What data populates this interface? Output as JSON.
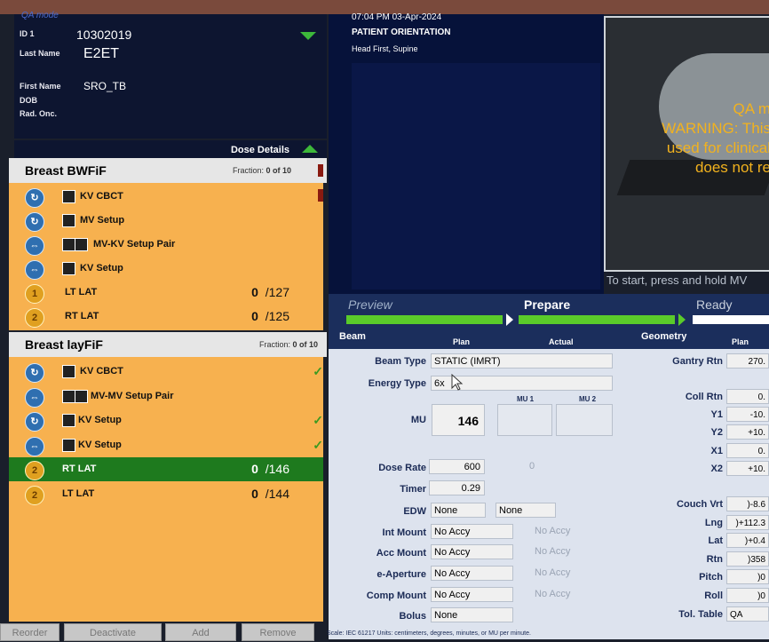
{
  "mode_label": "QA mode",
  "patient": {
    "id_label": "ID 1",
    "id_value": "10302019",
    "last_name_label": "Last Name",
    "last_name": "E2ET",
    "first_name_label": "First Name",
    "first_name": "SRO_TB",
    "dob_label": "DOB",
    "rad_onc_label": "Rad. Onc."
  },
  "dose_details_label": "Dose Details",
  "plans": [
    {
      "name": "Breast BWFiF",
      "fraction_label": "Fraction:",
      "fraction_value": "0 of 10",
      "fields": [
        {
          "name": "KV CBCT",
          "icon": "arc-icon"
        },
        {
          "name": "MV Setup",
          "icon": "arc-icon"
        },
        {
          "name": "MV-KV Setup Pair",
          "icon": "setup-icon"
        },
        {
          "name": "KV Setup",
          "icon": "setup-icon"
        },
        {
          "name": "LT LAT",
          "icon": "static-field-icon",
          "count": "0",
          "total": "/127"
        },
        {
          "name": "RT LAT",
          "icon": "static-field-icon",
          "count": "0",
          "total": "/125"
        }
      ]
    },
    {
      "name": "Breast layFiF",
      "fraction_label": "Fraction:",
      "fraction_value": "0 of 10",
      "fields": [
        {
          "name": "KV CBCT",
          "icon": "arc-icon"
        },
        {
          "name": "MV-MV Setup Pair",
          "icon": "setup-icon"
        },
        {
          "name": "KV Setup",
          "icon": "arc-icon"
        },
        {
          "name": "KV Setup",
          "icon": "setup-icon"
        },
        {
          "name": "RT LAT",
          "icon": "static-field-icon",
          "count": "0",
          "total": "/146",
          "selected": true
        },
        {
          "name": "LT LAT",
          "icon": "static-field-icon",
          "count": "0",
          "total": "/144"
        }
      ]
    }
  ],
  "buttons": {
    "reorder": "Reorder",
    "deactivate": "Deactivate",
    "add": "Add",
    "remove": "Remove"
  },
  "center": {
    "timestamp": "07:04 PM 03-Apr-2024",
    "orientation_title": "PATIENT ORIENTATION",
    "orientation_value": "Head First, Supine"
  },
  "camera": {
    "qa_text": "QA m",
    "warning_line1": "WARNING: This",
    "warning_line2": "used for clinical",
    "warning_line3": "does not re"
  },
  "hint": "To start, press and hold MV",
  "workflow": {
    "preview": "Preview",
    "prepare": "Prepare",
    "ready": "Ready"
  },
  "beam": {
    "title": "Beam",
    "plan_col": "Plan",
    "actual_col": "Actual",
    "beam_type_label": "Beam Type",
    "beam_type": "STATIC (IMRT)",
    "energy_type_label": "Energy Type",
    "energy_type": "6x",
    "mu_label": "MU",
    "mu_plan": "146",
    "mu1_label": "MU 1",
    "mu2_label": "MU 2",
    "dose_rate_label": "Dose Rate",
    "dose_rate": "600",
    "dose_rate_actual": "0",
    "timer_label": "Timer",
    "timer": "0.29",
    "edw_label": "EDW",
    "edw": "None",
    "edw_actual": "None",
    "int_mount_label": "Int Mount",
    "int_mount": "No Accy",
    "int_mount_actual": "No Accy",
    "acc_mount_label": "Acc Mount",
    "acc_mount": "No Accy",
    "acc_mount_actual": "No Accy",
    "e_aperture_label": "e-Aperture",
    "e_aperture": "No Accy",
    "e_aperture_actual": "No Accy",
    "comp_mount_label": "Comp Mount",
    "comp_mount": "No Accy",
    "comp_mount_actual": "No Accy",
    "bolus_label": "Bolus",
    "bolus": "None"
  },
  "geometry": {
    "title": "Geometry",
    "plan_col": "Plan",
    "gantry_rtn_label": "Gantry Rtn",
    "gantry_rtn": "270.",
    "coll_rtn_label": "Coll Rtn",
    "coll_rtn": "0.",
    "y1_label": "Y1",
    "y1": "-10.",
    "y2_label": "Y2",
    "y2": "+10.",
    "x1_label": "X1",
    "x1": "0.",
    "x2_label": "X2",
    "x2": "+10.",
    "couch_vrt_label": "Couch Vrt",
    "couch_vrt": ")-8.6",
    "lng_label": "Lng",
    "lng": ")+112.3",
    "lat_label": "Lat",
    "lat": ")+0.4",
    "rtn_label": "Rtn",
    "rtn": ")358",
    "pitch_label": "Pitch",
    "pitch": ")0",
    "roll_label": "Roll",
    "roll": ")0",
    "tol_table_label": "Tol. Table",
    "tol_table": "QA"
  },
  "footer": "Scale: IEC 61217     Units: centimeters, degrees, minutes, or MU per minute.",
  "colors": {
    "field_list_bg": "#f7b14f",
    "selected_field": "#1e7a1e",
    "panel_navy": "#0d1530",
    "warning_text": "#f2b21e"
  }
}
